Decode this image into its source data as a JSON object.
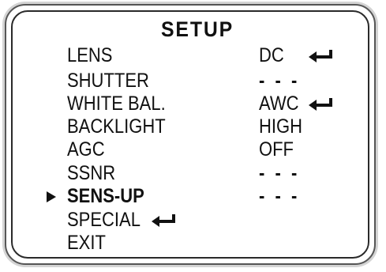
{
  "menu": {
    "title": "SETUP",
    "selected_index": 6,
    "items": [
      {
        "label": "LENS",
        "value": "DC",
        "has_submenu": true
      },
      {
        "label": "SHUTTER",
        "value": "- - -"
      },
      {
        "label": "WHITE BAL.",
        "value": "AWC",
        "has_submenu": true
      },
      {
        "label": "BACKLIGHT",
        "value": "HIGH"
      },
      {
        "label": "AGC",
        "value": "OFF"
      },
      {
        "label": "SSNR",
        "value": "- - -"
      },
      {
        "label": "SENS-UP",
        "value": "- - -"
      },
      {
        "label": "SPECIAL",
        "has_submenu": true
      },
      {
        "label": "EXIT"
      }
    ]
  },
  "icons": {
    "selection_cursor": "right-triangle-cursor",
    "submenu_indicator": "enter-return-arrow"
  },
  "colors": {
    "text": "#111111",
    "frame": "#2a2a2a",
    "background": "#ffffff"
  }
}
